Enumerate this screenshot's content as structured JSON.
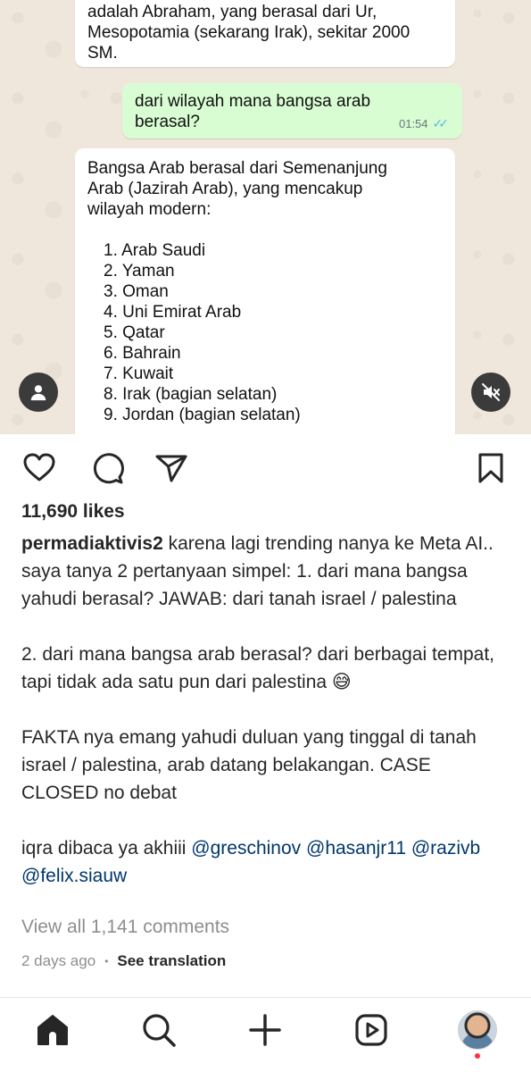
{
  "chat": {
    "message1_lines": [
      "adalah Abraham, yang berasal dari Ur,",
      "Mesopotamia (sekarang Irak), sekitar 2000",
      "SM."
    ],
    "message2_lines": [
      "dari wilayah mana bangsa arab",
      "berasal?"
    ],
    "message2_time": "01:54",
    "message3_lines": [
      "Bangsa Arab berasal dari Semenanjung",
      "Arab (Jazirah Arab), yang mencakup",
      "wilayah modern:"
    ],
    "message3_list": [
      "1. Arab Saudi",
      "2. Yaman",
      "3. Oman",
      "4. Uni Emirat Arab",
      "5. Qatar",
      "6. Bahrain",
      "7. Kuwait",
      "8. Irak (bagian selatan)",
      "9. Jordan (bagian selatan)"
    ]
  },
  "media_controls": {
    "left_icon": "person-icon",
    "right_icon": "volume-muted-icon"
  },
  "actions": {
    "like_icon": "heart-icon",
    "comment_icon": "comment-icon",
    "share_icon": "send-icon",
    "save_icon": "bookmark-icon"
  },
  "post": {
    "likes": "11,690 likes",
    "username": "permadiaktivis2",
    "caption_p1": "karena lagi trending nanya ke Meta AI.. saya tanya 2 pertanyaan simpel: 1. dari mana bangsa yahudi berasal? JAWAB: dari tanah israel / palestina",
    "caption_p2": "2. dari mana bangsa arab berasal? dari berbagai tempat, tapi tidak ada satu pun dari palestina 😅",
    "caption_p3": "FAKTA nya emang yahudi duluan yang tinggal di tanah israel / palestina, arab datang belakangan. CASE CLOSED no debat",
    "caption_p4_text": "iqra dibaca ya akhiii ",
    "mentions": [
      "@greschinov",
      "@hasanjr11",
      "@razivb",
      "@felix.siauw"
    ],
    "view_comments": "View all 1,141 comments",
    "time_ago": "2 days ago",
    "dot": "•",
    "see_translation": "See translation"
  },
  "nav": {
    "items": [
      "home-icon",
      "search-icon",
      "create-icon",
      "reels-icon",
      "profile-avatar"
    ]
  },
  "colors": {
    "chat_background": "#efe7dc",
    "outgoing_bubble": "#d9fdd3",
    "read_ticks": "#53bdeb",
    "mention": "#00376b",
    "notification_dot": "#ff3040"
  }
}
